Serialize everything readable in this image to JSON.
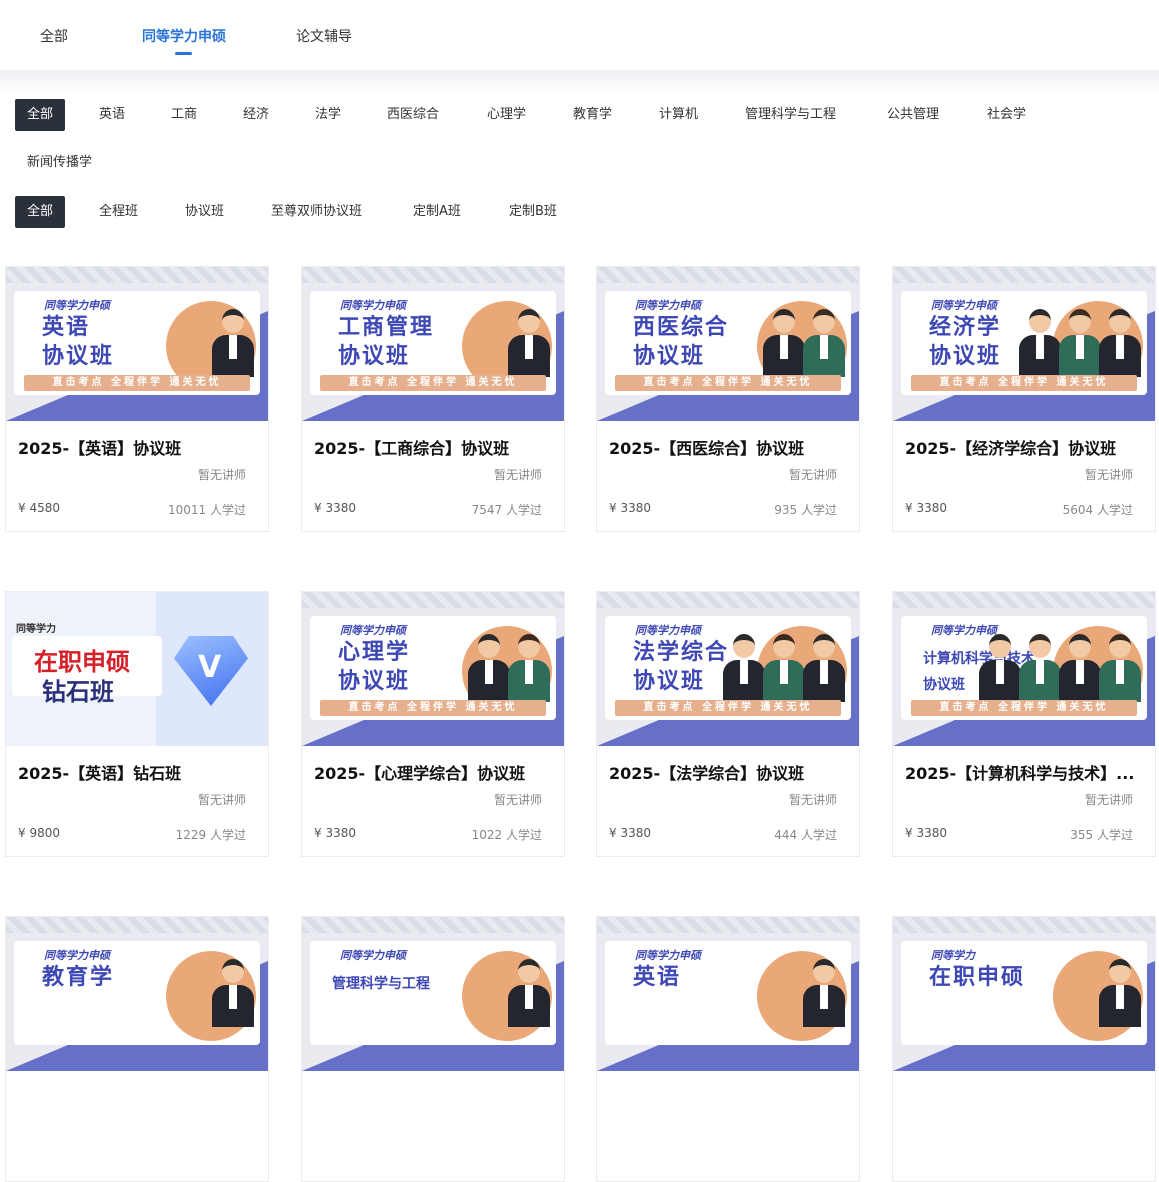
{
  "top_tabs": [
    "全部",
    "同等学力申硕",
    "论文辅导"
  ],
  "subjects": [
    "全部",
    "英语",
    "工商",
    "经济",
    "法学",
    "西医综合",
    "心理学",
    "教育学",
    "计算机",
    "管理科学与工程",
    "公共管理",
    "社会学",
    "新闻传播学"
  ],
  "class_types": [
    "全部",
    "全程班",
    "协议班",
    "至尊双师协议班",
    "定制A班",
    "定制B班"
  ],
  "cover_text": {
    "brand": "同等学力申硕",
    "slogan": "直击考点 全程伴学 通关无忧",
    "diamond_tag": "同等学力",
    "diamond_line1": "在职申硕",
    "diamond_line2": "钻石班"
  },
  "courses": [
    {
      "cover": "英语\n协议班",
      "title": "2025-【英语】协议班",
      "teacher": "暂无讲师",
      "price": "¥ 4580",
      "learned": "10011",
      "unit": "人学过"
    },
    {
      "cover": "工商管理\n协议班",
      "title": "2025-【工商综合】协议班",
      "teacher": "暂无讲师",
      "price": "¥ 3380",
      "learned": "7547",
      "unit": "人学过"
    },
    {
      "cover": "西医综合\n协议班",
      "title": "2025-【西医综合】协议班",
      "teacher": "暂无讲师",
      "price": "¥ 3380",
      "learned": "935",
      "unit": "人学过"
    },
    {
      "cover": "经济学\n协议班",
      "title": "2025-【经济学综合】协议班",
      "teacher": "暂无讲师",
      "price": "¥ 3380",
      "learned": "5604",
      "unit": "人学过"
    },
    {
      "cover": "",
      "title": "2025-【英语】钻石班",
      "teacher": "暂无讲师",
      "price": "¥ 9800",
      "learned": "1229",
      "unit": "人学过"
    },
    {
      "cover": "心理学\n协议班",
      "title": "2025-【心理学综合】协议班",
      "teacher": "暂无讲师",
      "price": "¥ 3380",
      "learned": "1022",
      "unit": "人学过"
    },
    {
      "cover": "法学综合\n协议班",
      "title": "2025-【法学综合】协议班",
      "teacher": "暂无讲师",
      "price": "¥ 3380",
      "learned": "444",
      "unit": "人学过"
    },
    {
      "cover": "计算机科学与技术\n协议班",
      "title": "2025-【计算机科学与技术】...",
      "teacher": "暂无讲师",
      "price": "¥ 3380",
      "learned": "355",
      "unit": "人学过"
    }
  ],
  "partial_covers": [
    {
      "brand": "同等学力申硕",
      "big": "教育学"
    },
    {
      "brand": "同等学力申硕",
      "big": "管理科学与工程"
    },
    {
      "brand": "同等学力申硕",
      "big": "英语"
    },
    {
      "brand": "同等学力",
      "big": "在职申硕"
    }
  ]
}
